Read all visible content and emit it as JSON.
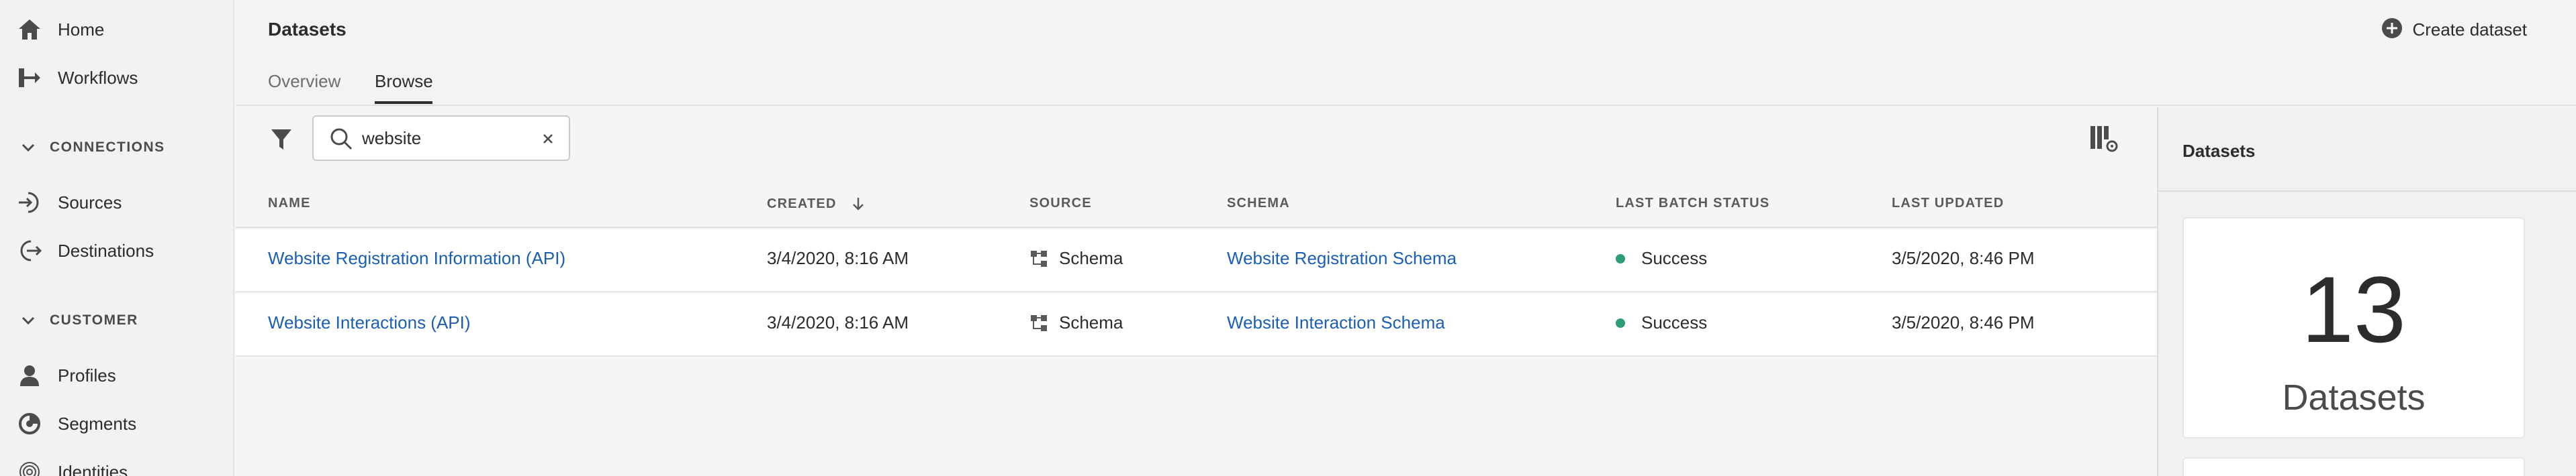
{
  "sidebar": {
    "items": [
      {
        "label": "Home",
        "icon": "home-icon"
      },
      {
        "label": "Workflows",
        "icon": "workflows-icon"
      },
      {
        "label": "Sources",
        "icon": "sources-icon"
      },
      {
        "label": "Destinations",
        "icon": "destinations-icon"
      },
      {
        "label": "Profiles",
        "icon": "profile-icon"
      },
      {
        "label": "Segments",
        "icon": "segments-icon"
      },
      {
        "label": "Identities",
        "icon": "fingerprint-icon"
      }
    ],
    "sections": {
      "connections": "CONNECTIONS",
      "customer": "CUSTOMER"
    }
  },
  "header": {
    "title": "Datasets",
    "create_label": "Create dataset",
    "tabs": [
      {
        "label": "Overview",
        "active": false
      },
      {
        "label": "Browse",
        "active": true
      }
    ]
  },
  "search": {
    "value": "website",
    "placeholder": ""
  },
  "table": {
    "columns": [
      "NAME",
      "CREATED",
      "SOURCE",
      "SCHEMA",
      "LAST BATCH STATUS",
      "LAST UPDATED"
    ],
    "sorted_column": "CREATED",
    "rows": [
      {
        "name": "Website Registration Information (API)",
        "created": "3/4/2020, 8:16 AM",
        "source": "Schema",
        "schema": "Website Registration Schema",
        "status": "Success",
        "updated": "3/5/2020, 8:46 PM"
      },
      {
        "name": "Website Interactions (API)",
        "created": "3/4/2020, 8:16 AM",
        "source": "Schema",
        "schema": "Website Interaction Schema",
        "status": "Success",
        "updated": "3/5/2020, 8:46 PM"
      }
    ]
  },
  "right_panel": {
    "title": "Datasets",
    "count": "13",
    "count_label": "Datasets"
  },
  "colors": {
    "link": "#1a5fb4",
    "success": "#2d9d78"
  }
}
